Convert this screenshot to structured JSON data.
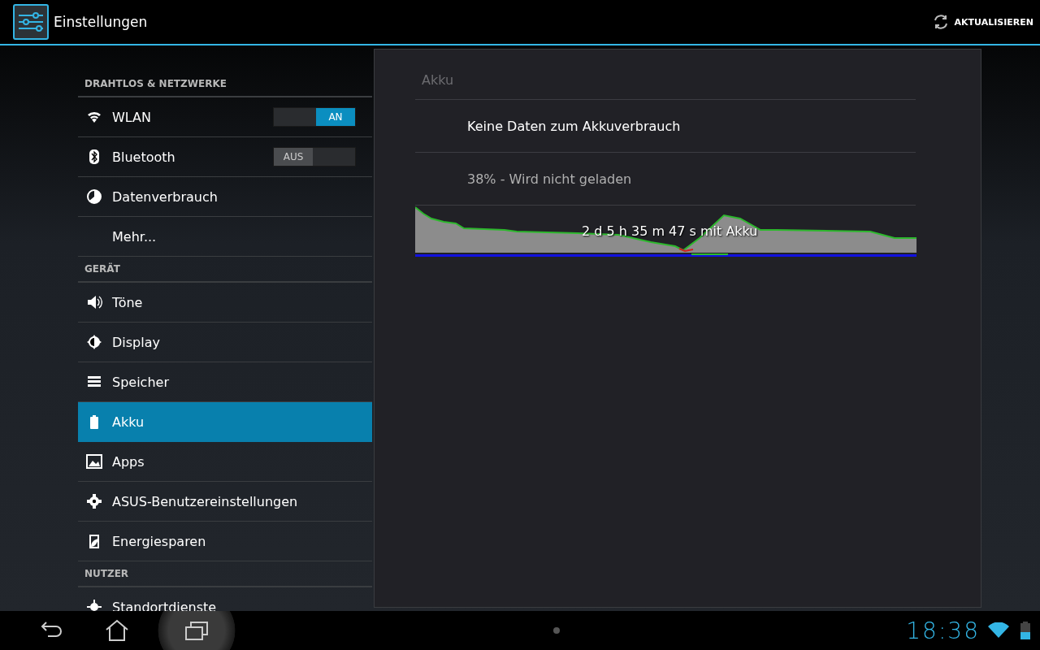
{
  "action_bar": {
    "title": "Einstellungen",
    "action": "AKTUALISIEREN"
  },
  "sections": [
    {
      "header": "DRAHTLOS & NETZWERKE",
      "items": [
        {
          "label": "WLAN",
          "selected": false,
          "switch": {
            "label": "AN",
            "on": true
          }
        },
        {
          "label": "Bluetooth",
          "selected": false,
          "switch": {
            "label": "AUS",
            "on": false
          }
        },
        {
          "label": "Datenverbrauch",
          "selected": false
        },
        {
          "label": "Mehr...",
          "selected": false
        }
      ]
    },
    {
      "header": "GERÄT",
      "items": [
        {
          "label": "Töne",
          "selected": false
        },
        {
          "label": "Display",
          "selected": false
        },
        {
          "label": "Speicher",
          "selected": false
        },
        {
          "label": "Akku",
          "selected": true
        },
        {
          "label": "Apps",
          "selected": false
        },
        {
          "label": "ASUS-Benutzereinstellungen",
          "selected": false
        },
        {
          "label": "Energiesparen",
          "selected": false
        }
      ]
    },
    {
      "header": "NUTZER",
      "items": [
        {
          "label": "Standortdienste",
          "selected": false
        }
      ]
    }
  ],
  "detail": {
    "title": "Akku",
    "rows": [
      "Keine Daten zum Akkuverbrauch",
      "38% - Wird nicht geladen"
    ],
    "graph_label": "2 d 5 h 35 m 47 s mit Akku"
  },
  "nav_bar": {
    "time": "18:38"
  }
}
